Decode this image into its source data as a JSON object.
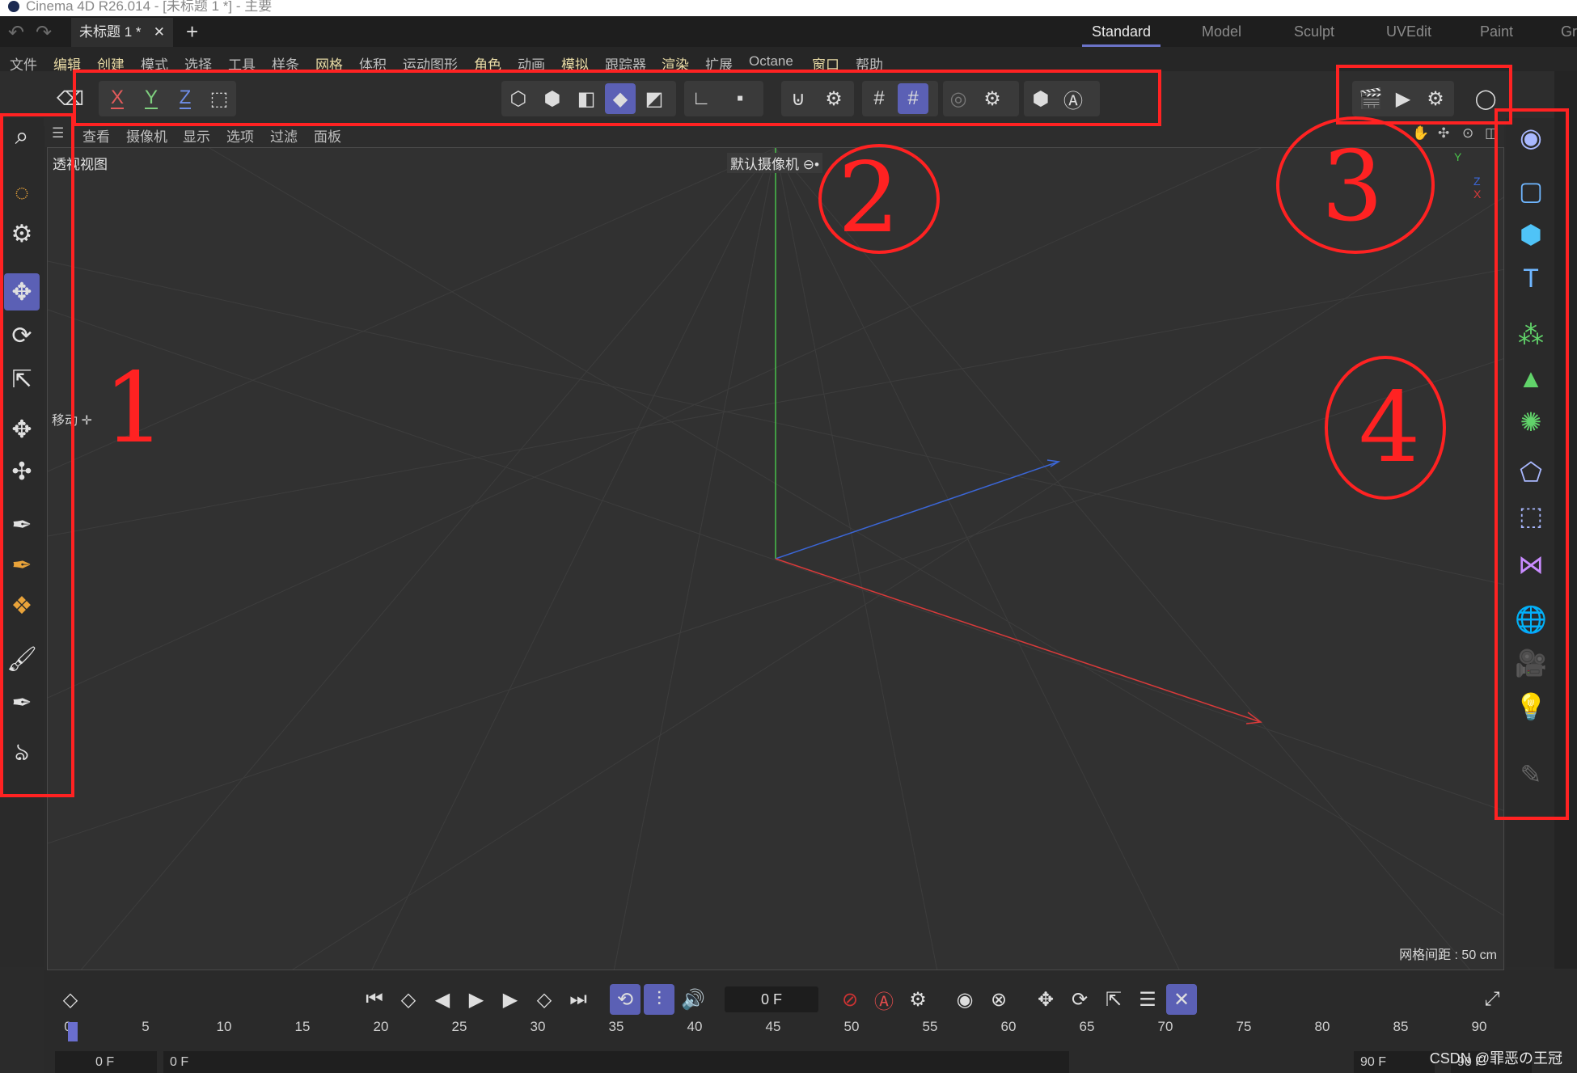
{
  "window": {
    "title": "Cinema 4D R26.014 - [未标题 1 *] - 主要"
  },
  "tabbar": {
    "doc_tab": "未标题 1 *",
    "close_glyph": "✕",
    "add_glyph": "+"
  },
  "layouts": [
    "Standard",
    "Model",
    "Sculpt",
    "UVEdit",
    "Paint",
    "Gr"
  ],
  "menu": [
    "文件",
    "编辑",
    "创建",
    "模式",
    "选择",
    "工具",
    "样条",
    "网格",
    "体积",
    "运动图形",
    "角色",
    "动画",
    "模拟",
    "跟踪器",
    "渲染",
    "扩展",
    "Octane",
    "窗口",
    "帮助"
  ],
  "toolbar": {
    "axes": [
      "X",
      "Y",
      "Z"
    ],
    "icons": [
      "undo-history-icon",
      "coordinate-system-icon",
      "points-mode-icon",
      "edges-mode-icon",
      "polygons-mode-icon",
      "model-mode-icon",
      "texture-mode-icon",
      "axis-mode-icon",
      "solo-icon",
      "snap-icon",
      "snap-settings-icon",
      "grid-icon",
      "grid-snap-icon",
      "radial-icon",
      "settings-icon",
      "viewport-display-icon",
      "auto-icon"
    ],
    "render_icons": [
      "render-view-icon",
      "render-to-picture-viewer-icon",
      "render-settings-icon",
      "render-region-icon"
    ]
  },
  "left_tools": [
    "search-icon",
    "live-select-icon",
    "selection-settings-icon",
    "move-icon",
    "rotate-icon",
    "scale-icon",
    "transform-icon",
    "axis-move-icon",
    "pen-icon",
    "spline-pen-icon",
    "mograph-paint-icon",
    "brush-icon",
    "spline-knife-icon",
    "sketch-icon"
  ],
  "viewport": {
    "menus": [
      "查看",
      "摄像机",
      "显示",
      "选项",
      "过滤",
      "面板"
    ],
    "view_name": "透视视图",
    "camera": "默认摄像机",
    "camera_glyph": "⊖•",
    "move_tip": "移动",
    "move_tip_glyph": "✛",
    "grid_spacing": "网格间距 : 50 cm",
    "axis_labels": {
      "x": "X",
      "y": "Y",
      "z": "Z"
    }
  },
  "right_tools": [
    "null-object-icon",
    "spline-rectangle-icon",
    "cube-icon",
    "text-icon",
    "cloner-icon",
    "effector-icon",
    "field-icon",
    "deformer-icon",
    "scene-object-icon",
    "generator-icon",
    "environment-icon",
    "camera-icon",
    "light-icon",
    "tag-icon"
  ],
  "timeline": {
    "current_frame": "0 F",
    "ticks": [
      "0",
      "5",
      "10",
      "15",
      "20",
      "25",
      "30",
      "35",
      "40",
      "45",
      "50",
      "55",
      "60",
      "65",
      "70",
      "75",
      "80",
      "85",
      "90"
    ],
    "start_field": "0 F",
    "min_field": "0 F",
    "end_field": "90 F",
    "max_field": "90 F"
  },
  "annotations": {
    "label_1": "1",
    "label_2": "2",
    "label_3": "3",
    "label_4": "4",
    "color": "#ff2222"
  },
  "watermark": "CSDN @罪恶の王冠",
  "colors": {
    "accent": "#5b60b5",
    "x_axis": "#e35b5b",
    "y_axis": "#7fd07f",
    "z_axis": "#6f8de8",
    "background": "#2b2b2b"
  }
}
